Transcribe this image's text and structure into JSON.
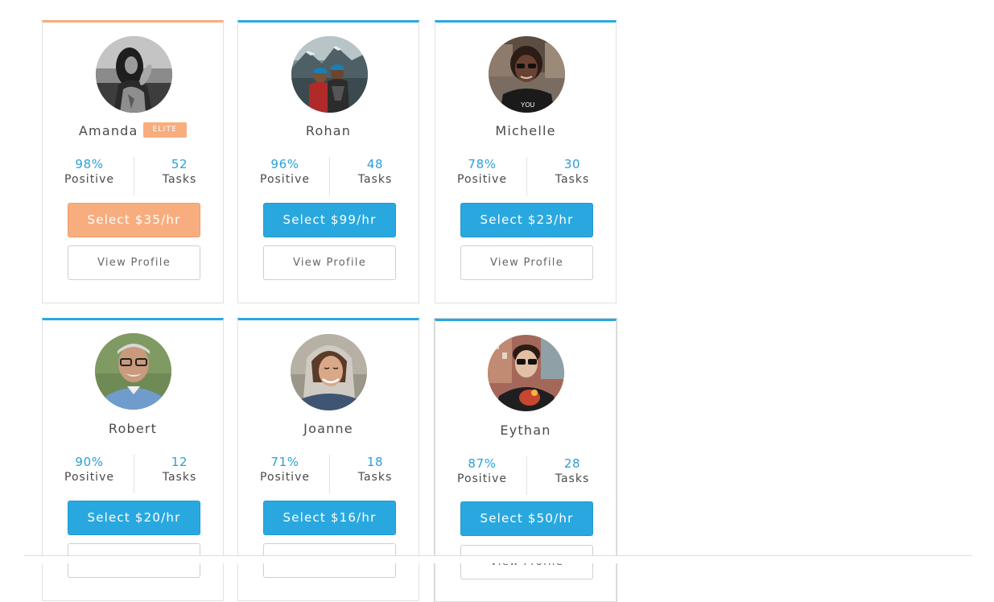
{
  "colors": {
    "accent": "#29a8e0",
    "elite": "#f8ad7f",
    "stat_value": "#2aa0d8",
    "text": "#4a4a4a",
    "border": "#e1e1e1"
  },
  "labels": {
    "positive": "Positive",
    "tasks": "Tasks",
    "view_profile": "View Profile",
    "elite_badge": "ELITE"
  },
  "workers": [
    {
      "name": "Amanda",
      "elite": true,
      "positive": "98%",
      "tasks": "52",
      "select_label": "Select $35/hr",
      "avatar_icon": "avatar-photo-woman-bw"
    },
    {
      "name": "Rohan",
      "elite": false,
      "positive": "96%",
      "tasks": "48",
      "select_label": "Select $99/hr",
      "avatar_icon": "avatar-photo-couple-mountains"
    },
    {
      "name": "Michelle",
      "elite": false,
      "positive": "78%",
      "tasks": "30",
      "select_label": "Select $23/hr",
      "avatar_icon": "avatar-photo-woman-sunglasses"
    },
    {
      "name": "Robert",
      "elite": false,
      "positive": "90%",
      "tasks": "12",
      "select_label": "Select $20/hr",
      "avatar_icon": "avatar-photo-man-glasses"
    },
    {
      "name": "Joanne",
      "elite": false,
      "positive": "71%",
      "tasks": "18",
      "select_label": "Select $16/hr",
      "avatar_icon": "avatar-photo-woman-hood"
    },
    {
      "name": "Eythan",
      "elite": false,
      "positive": "87%",
      "tasks": "28",
      "select_label": "Select $50/hr",
      "avatar_icon": "avatar-photo-man-sunglasses"
    }
  ]
}
